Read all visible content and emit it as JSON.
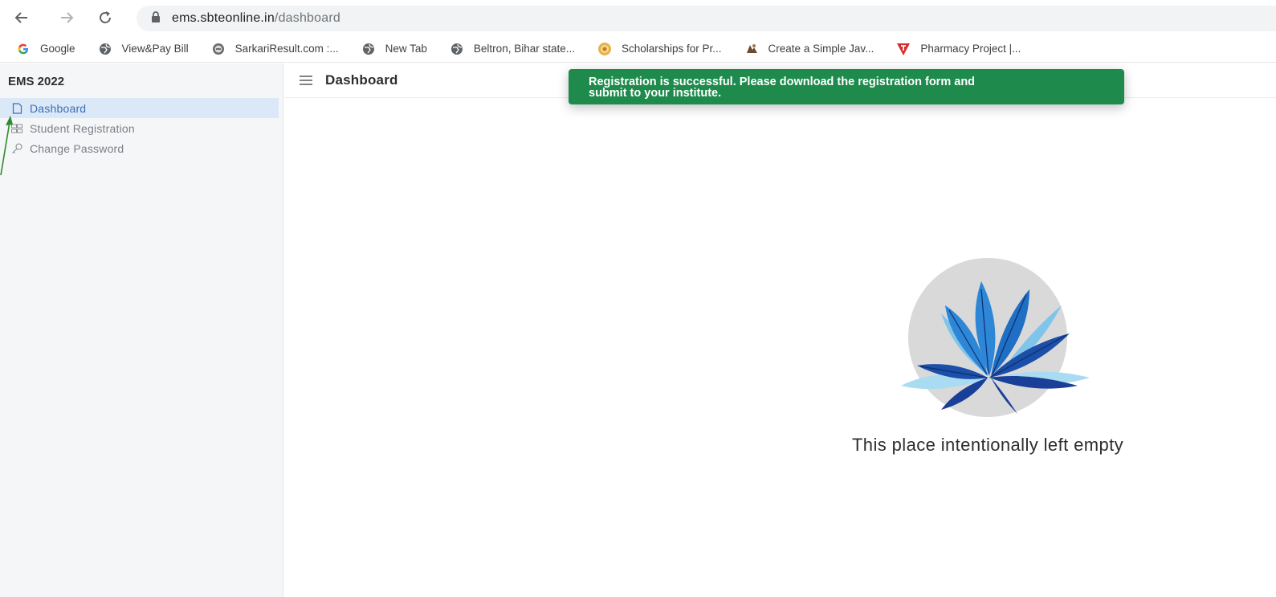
{
  "browser": {
    "url_host": "ems.sbteonline.in",
    "url_path": "/dashboard",
    "icons": {
      "back": "arrow-left-icon",
      "forward": "arrow-right-icon",
      "reload": "reload-icon",
      "lock": "lock-icon"
    }
  },
  "bookmarks": [
    {
      "label": "Google",
      "icon": "google-icon"
    },
    {
      "label": "View&Pay Bill",
      "icon": "globe-icon"
    },
    {
      "label": "SarkariResult.com :...",
      "icon": "globe-icon"
    },
    {
      "label": "New Tab",
      "icon": "globe-icon"
    },
    {
      "label": "Beltron, Bihar state...",
      "icon": "globe-icon"
    },
    {
      "label": "Scholarships for Pr...",
      "icon": "award-icon"
    },
    {
      "label": "Create a Simple Jav...",
      "icon": "site-icon"
    },
    {
      "label": "Pharmacy Project |...",
      "icon": "pharmacy-icon"
    }
  ],
  "sidebar": {
    "brand": "EMS 2022",
    "items": [
      {
        "label": "Dashboard",
        "icon": "page-icon",
        "active": true
      },
      {
        "label": "Student Registration",
        "icon": "registration-icon",
        "active": false
      },
      {
        "label": "Change Password",
        "icon": "key-icon",
        "active": false
      }
    ]
  },
  "header": {
    "title": "Dashboard",
    "menu_icon": "hamburger-icon"
  },
  "toast": {
    "line1": "Registration is successful. Please download the registration form and",
    "line2": "submit to your institute.",
    "color": "#1e8a4c"
  },
  "empty_state": {
    "message": "This place intentionally left empty",
    "icon": "plant-illustration"
  },
  "colors": {
    "active_item_bg": "#dbe8f8",
    "active_item_text": "#3b6fb6",
    "sidebar_bg": "#f5f6f8",
    "annotation_arrow": "#2e8b2e"
  }
}
